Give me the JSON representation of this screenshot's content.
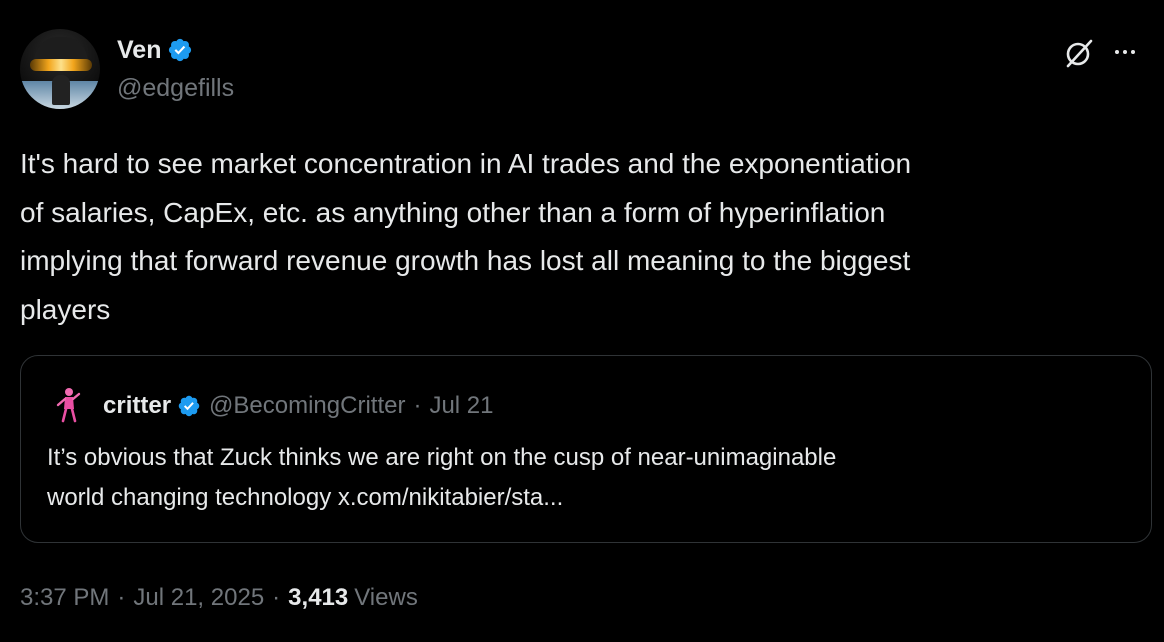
{
  "author": {
    "display_name": "Ven",
    "handle": "@edgefills",
    "verified": true
  },
  "icons": {
    "verified": "verified-badge-icon",
    "grok": "grok-icon",
    "more": "more-options-icon"
  },
  "colors": {
    "verified_blue": "#1d9bf0",
    "background": "#000000",
    "text_primary": "#e7e9ea",
    "text_secondary": "#71767b",
    "border": "#2f3336"
  },
  "tweet": {
    "lines": [
      "It's hard to see market concentration in AI trades and the exponentiation",
      "of salaries, CapEx, etc. as anything other than a form of hyperinflation",
      "implying that forward revenue growth has lost all meaning to the biggest",
      "players"
    ]
  },
  "quote": {
    "display_name": "critter",
    "handle": "@BecomingCritter",
    "separator": "·",
    "date": "Jul 21",
    "line1": "It’s obvious that Zuck thinks we are right on the cusp of near-unimaginable",
    "line2": "world changing technology x.com/nikitabier/sta..."
  },
  "meta": {
    "time": "3:37 PM",
    "separator": "·",
    "date": "Jul 21, 2025",
    "views_count": "3,413",
    "views_label": "Views"
  }
}
